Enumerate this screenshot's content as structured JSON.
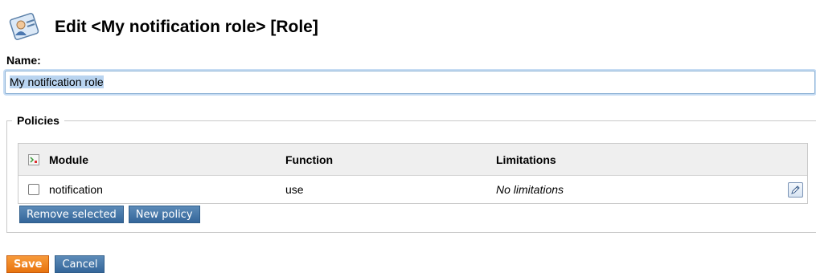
{
  "header": {
    "title": "Edit <My notification role> [Role]",
    "icon": "role-card-icon"
  },
  "name_field": {
    "label": "Name:",
    "value": "My notification role"
  },
  "policies": {
    "legend": "Policies",
    "columns": {
      "module": "Module",
      "function": "Function",
      "limitations": "Limitations"
    },
    "rows": [
      {
        "module": "notification",
        "function": "use",
        "limitations": "No limitations"
      }
    ],
    "remove_label": "Remove selected",
    "new_label": "New policy"
  },
  "actions": {
    "save_label": "Save",
    "cancel_label": "Cancel"
  },
  "colors": {
    "primary_button": "#34669a",
    "save_button": "#e8740f",
    "table_header_bg": "#efefef"
  }
}
